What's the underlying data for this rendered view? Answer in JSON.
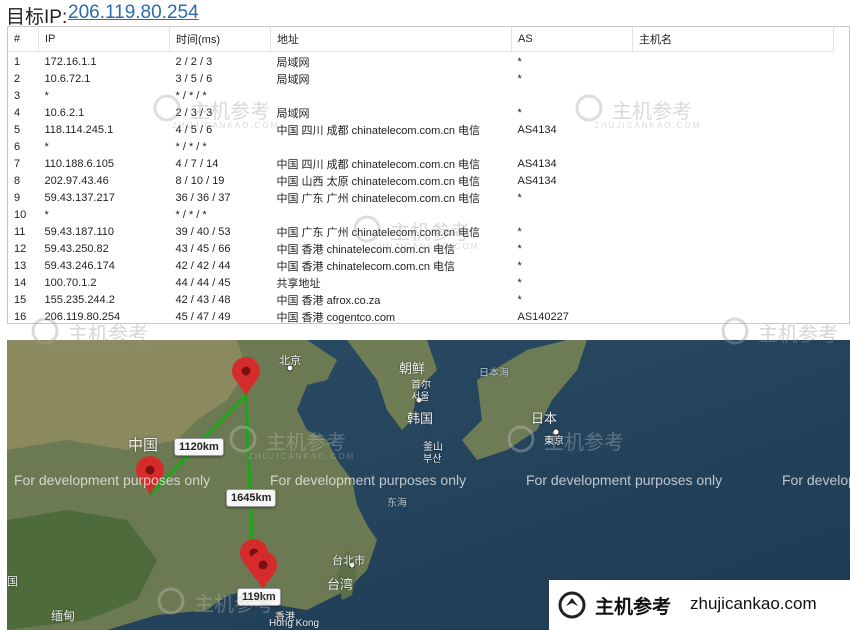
{
  "header": {
    "label": "目标IP:",
    "ip": "206.119.80.254"
  },
  "table": {
    "columns": [
      "#",
      "IP",
      "时间(ms)",
      "地址",
      "AS",
      "主机名"
    ],
    "rows": [
      [
        "1",
        "172.16.1.1",
        "2 / 2 / 3",
        "局域网",
        "*",
        ""
      ],
      [
        "2",
        "10.6.72.1",
        "3 / 5 / 6",
        "局域网",
        "*",
        ""
      ],
      [
        "3",
        "*",
        "* / * / *",
        "",
        "",
        ""
      ],
      [
        "4",
        "10.6.2.1",
        "2 / 3 / 3",
        "局域网",
        "*",
        ""
      ],
      [
        "5",
        "118.114.245.1",
        "4 / 5 / 6",
        "中国 四川 成都 chinatelecom.com.cn 电信",
        "AS4134",
        ""
      ],
      [
        "6",
        "*",
        "* / * / *",
        "",
        "",
        ""
      ],
      [
        "7",
        "110.188.6.105",
        "4 / 7 / 14",
        "中国 四川 成都 chinatelecom.com.cn 电信",
        "AS4134",
        ""
      ],
      [
        "8",
        "202.97.43.46",
        "8 / 10 / 19",
        "中国 山西 太原 chinatelecom.com.cn 电信",
        "AS4134",
        ""
      ],
      [
        "9",
        "59.43.137.217",
        "36 / 36 / 37",
        "中国 广东 广州 chinatelecom.com.cn 电信",
        "*",
        ""
      ],
      [
        "10",
        "*",
        "* / * / *",
        "",
        "",
        ""
      ],
      [
        "11",
        "59.43.187.110",
        "39 / 40 / 53",
        "中国 广东 广州 chinatelecom.com.cn 电信",
        "*",
        ""
      ],
      [
        "12",
        "59.43.250.82",
        "43 / 45 / 66",
        "中国 香港 chinatelecom.com.cn 电信",
        "*",
        ""
      ],
      [
        "13",
        "59.43.246.174",
        "42 / 42 / 44",
        "中国 香港 chinatelecom.com.cn 电信",
        "*",
        ""
      ],
      [
        "14",
        "100.70.1.2",
        "44 / 44 / 45",
        "共享地址",
        "*",
        ""
      ],
      [
        "15",
        "155.235.244.2",
        "42 / 43 / 48",
        "中国 香港 afrox.co.za",
        "*",
        ""
      ],
      [
        "16",
        "206.119.80.254",
        "45 / 47 / 49",
        "中国 香港 cogentco.com",
        "AS140227",
        ""
      ]
    ]
  },
  "map": {
    "dev_notice": "For development purposes only",
    "places": {
      "beijing": "北京",
      "korea_n": "朝鲜",
      "pyongyang": "首尔",
      "seoul": "서울",
      "korea": "韩国",
      "busan": "釜山",
      "busan_kr": "부산",
      "japan_sea": "日本海",
      "japan": "日本",
      "tokyo": "東京",
      "china": "中国",
      "east_sea": "东海",
      "taipei": "台北市",
      "taiwan": "台湾",
      "hongkong_cn": "香港",
      "hongkong": "Hong Kong",
      "myanmar": "缅甸",
      "edge_char": "国"
    },
    "distances": {
      "d1": "1120km",
      "d2": "1645km",
      "d3": "119km"
    },
    "colors": {
      "route": "#1aa81a",
      "marker": "#d62b2b"
    }
  },
  "watermark": {
    "cn": "主机参考",
    "pinyin": "ZHUJICANKAO.COM"
  },
  "brand": {
    "name": "主机参考",
    "url": "zhujicankao.com"
  }
}
